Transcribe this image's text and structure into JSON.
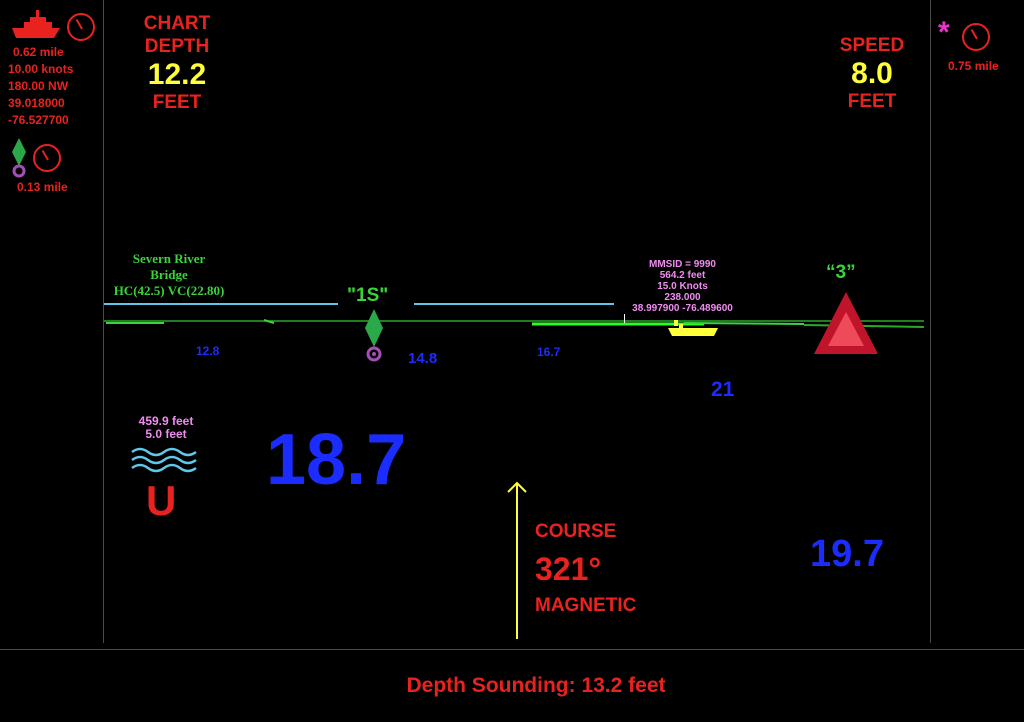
{
  "vessel": {
    "distance": "0.62 mile",
    "speed": "10.00 knots",
    "heading": "180.00 NW",
    "lat": "39.018000",
    "lon": "-76.527700"
  },
  "marker_left": {
    "distance": "0.13 mile"
  },
  "marker_right": {
    "distance": "0.75 mile"
  },
  "chart_depth": {
    "line1": "CHART",
    "line2": "DEPTH",
    "value": "12.2",
    "unit": "FEET"
  },
  "speed_panel": {
    "label": "SPEED",
    "value": "8.0",
    "unit": "FEET"
  },
  "bridge": {
    "name_line1": "Severn River",
    "name_line2": "Bridge",
    "clearance": "HC(42.5) VC(22.80)"
  },
  "buoy_1s": {
    "label": "\"1S\""
  },
  "buoy_3": {
    "label": "“3”"
  },
  "ais_target": {
    "mmsid": "MMSID = 9990",
    "distance": "564.2 feet",
    "speed": "15.0 Knots",
    "course": "238.000",
    "position": "38.997900  -76.489600"
  },
  "soundings": {
    "s1": "12.8",
    "s2": "14.8",
    "s3": "16.7",
    "s4": "21"
  },
  "current": {
    "distance": "459.9 feet",
    "depth": "5.0 feet",
    "symbol": "U"
  },
  "big_depth_left": "18.7",
  "big_depth_right": "19.7",
  "course_panel": {
    "label": "COURSE",
    "value": "321°",
    "ref": "MAGNETIC"
  },
  "footer": {
    "text": "Depth Sounding: 13.2 feet"
  },
  "colors": {
    "red": "#e8231f",
    "yellow": "#ffff3a",
    "blue": "#1b2cff",
    "green": "#3ad33a",
    "pink": "#f08cf0"
  }
}
